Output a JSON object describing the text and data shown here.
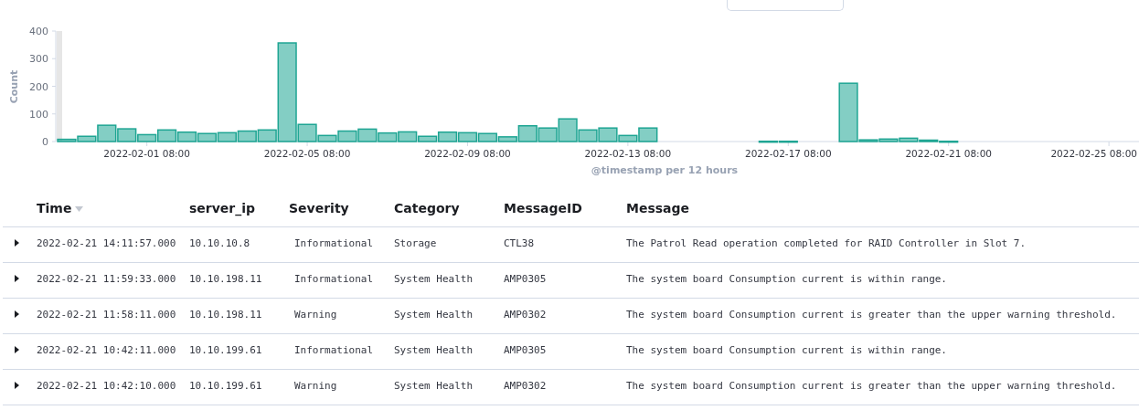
{
  "chart_data": {
    "type": "bar",
    "xlabel": "@timestamp per 12 hours",
    "ylabel": "Count",
    "categories": [
      null,
      null,
      null,
      null,
      "2022-02-01 08:00",
      null,
      null,
      null,
      null,
      null,
      null,
      null,
      "2022-02-05 08:00",
      null,
      null,
      null,
      null,
      null,
      null,
      null,
      "2022-02-09 08:00",
      null,
      null,
      null,
      null,
      null,
      null,
      null,
      "2022-02-13 08:00",
      null,
      null,
      null,
      null,
      null,
      null,
      null,
      "2022-02-17 08:00",
      null,
      null,
      null,
      null,
      null,
      null,
      null,
      "2022-02-21 08:00",
      null,
      null,
      null,
      null,
      null,
      null,
      null,
      "2022-02-25 08:00",
      null
    ],
    "series": [
      {
        "color": "#1ea593",
        "values": [
          8,
          19,
          59,
          46,
          25,
          42,
          34,
          29,
          32,
          38,
          42,
          357,
          62,
          22,
          38,
          45,
          31,
          35,
          19,
          34,
          32,
          29,
          17,
          57,
          49,
          82,
          42,
          49,
          22,
          49,
          null,
          null,
          null,
          null,
          null,
          1,
          1,
          null,
          null,
          211,
          6,
          9,
          12,
          5,
          1,
          null,
          null,
          null,
          null,
          null,
          null,
          null,
          null,
          null
        ]
      }
    ],
    "ylim": [
      0,
      400
    ],
    "yticks": [
      0,
      100,
      200,
      300,
      400
    ]
  },
  "table": {
    "columns": [
      {
        "label": "Time",
        "sorted": true
      },
      {
        "label": "server_ip",
        "sorted": false
      },
      {
        "label": "Severity",
        "sorted": false
      },
      {
        "label": "Category",
        "sorted": false
      },
      {
        "label": "MessageID",
        "sorted": false
      },
      {
        "label": "Message",
        "sorted": false
      }
    ],
    "rows": [
      {
        "expanded": false,
        "cells": [
          "2022-02-21 14:11:57.000",
          "10.10.10.8",
          "Informational",
          "Storage",
          "CTL38",
          "The Patrol Read operation completed for RAID Controller in Slot 7."
        ]
      },
      {
        "expanded": false,
        "cells": [
          "2022-02-21 11:59:33.000",
          "10.10.198.11",
          "Informational",
          "System Health",
          "AMP0305",
          "The system board Consumption current is within range."
        ]
      },
      {
        "expanded": false,
        "cells": [
          "2022-02-21 11:58:11.000",
          "10.10.198.11",
          "Warning",
          "System Health",
          "AMP0302",
          "The system board Consumption current is greater than the upper warning threshold."
        ]
      },
      {
        "expanded": false,
        "cells": [
          "2022-02-21 10:42:11.000",
          "10.10.199.61",
          "Informational",
          "System Health",
          "AMP0305",
          "The system board Consumption current is within range."
        ]
      },
      {
        "expanded": false,
        "cells": [
          "2022-02-21 10:42:10.000",
          "10.10.199.61",
          "Warning",
          "System Health",
          "AMP0302",
          "The system board Consumption current is greater than the upper warning threshold."
        ]
      }
    ]
  }
}
